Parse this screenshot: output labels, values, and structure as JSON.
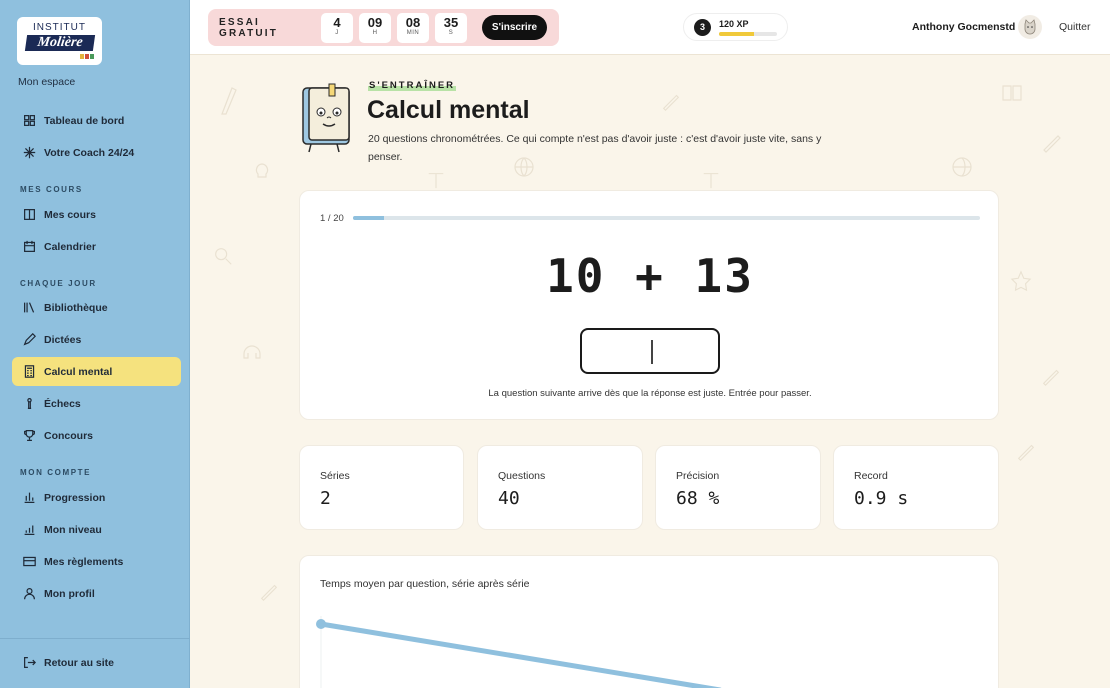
{
  "sidebar": {
    "logo_top": "INSTITUT",
    "logo_name": "Molière",
    "mon_espace": "Mon espace",
    "items": [
      {
        "label": "Tableau de bord"
      },
      {
        "label": "Votre Coach 24/24"
      },
      {
        "label": "Mes cours"
      },
      {
        "label": "Calendrier"
      },
      {
        "label": "Bibliothèque"
      },
      {
        "label": "Dictées"
      },
      {
        "label": "Calcul mental"
      },
      {
        "label": "Échecs"
      },
      {
        "label": "Concours"
      },
      {
        "label": "Progression"
      },
      {
        "label": "Mon niveau"
      },
      {
        "label": "Mes règlements"
      },
      {
        "label": "Mon profil"
      },
      {
        "label": "Retour au site"
      }
    ],
    "sections": {
      "mes_cours": "MES COURS",
      "chaque_jour": "CHAQUE JOUR",
      "mon_compte": "MON COMPTE"
    }
  },
  "topbar": {
    "trial_label": "ESSAI GRATUIT",
    "timer": [
      {
        "value": "4",
        "unit": "J"
      },
      {
        "value": "09",
        "unit": "H"
      },
      {
        "value": "08",
        "unit": "MIN"
      },
      {
        "value": "35",
        "unit": "S"
      }
    ],
    "signup_label": "S'inscrire",
    "xp_level": "3",
    "xp_text": "120 XP",
    "xp_progress": 0.6,
    "user_name": "Anthony Gocmenstd",
    "quit_label": "Quitter"
  },
  "header": {
    "kicker": "S'ENTRAÎNER",
    "title": "Calcul mental",
    "subtitle": "20 questions chronométrées. Ce qui compte n'est pas d'avoir juste : c'est d'avoir juste vite, sans y penser."
  },
  "exercise": {
    "progress_label": "1 / 20",
    "progress": 0.05,
    "question": "10 + 13",
    "answer_value": "",
    "hint": "La question suivante arrive dès que la réponse est juste. Entrée pour passer."
  },
  "stats": [
    {
      "label": "Séries",
      "value": "2"
    },
    {
      "label": "Questions",
      "value": "40"
    },
    {
      "label": "Précision",
      "value": "68 %"
    },
    {
      "label": "Record",
      "value": "0.9 s"
    }
  ],
  "chart": {
    "title": "Temps moyen par question, série après série"
  },
  "colors": {
    "sidebar": "#8fc0de",
    "active_item": "#f5e27e",
    "trial_bg": "#f8d9d9",
    "chart_line": "#8fc0de"
  }
}
